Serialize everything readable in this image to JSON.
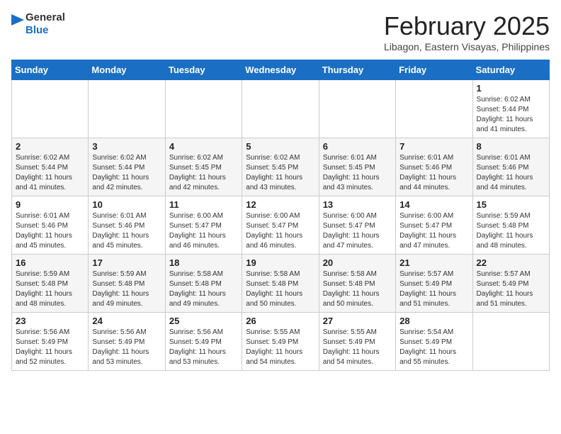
{
  "header": {
    "logo_general": "General",
    "logo_blue": "Blue",
    "month_title": "February 2025",
    "location": "Libagon, Eastern Visayas, Philippines"
  },
  "weekdays": [
    "Sunday",
    "Monday",
    "Tuesday",
    "Wednesday",
    "Thursday",
    "Friday",
    "Saturday"
  ],
  "weeks": [
    [
      {
        "day": "",
        "info": ""
      },
      {
        "day": "",
        "info": ""
      },
      {
        "day": "",
        "info": ""
      },
      {
        "day": "",
        "info": ""
      },
      {
        "day": "",
        "info": ""
      },
      {
        "day": "",
        "info": ""
      },
      {
        "day": "1",
        "info": "Sunrise: 6:02 AM\nSunset: 5:44 PM\nDaylight: 11 hours and 41 minutes."
      }
    ],
    [
      {
        "day": "2",
        "info": "Sunrise: 6:02 AM\nSunset: 5:44 PM\nDaylight: 11 hours and 41 minutes."
      },
      {
        "day": "3",
        "info": "Sunrise: 6:02 AM\nSunset: 5:44 PM\nDaylight: 11 hours and 42 minutes."
      },
      {
        "day": "4",
        "info": "Sunrise: 6:02 AM\nSunset: 5:45 PM\nDaylight: 11 hours and 42 minutes."
      },
      {
        "day": "5",
        "info": "Sunrise: 6:02 AM\nSunset: 5:45 PM\nDaylight: 11 hours and 43 minutes."
      },
      {
        "day": "6",
        "info": "Sunrise: 6:01 AM\nSunset: 5:45 PM\nDaylight: 11 hours and 43 minutes."
      },
      {
        "day": "7",
        "info": "Sunrise: 6:01 AM\nSunset: 5:46 PM\nDaylight: 11 hours and 44 minutes."
      },
      {
        "day": "8",
        "info": "Sunrise: 6:01 AM\nSunset: 5:46 PM\nDaylight: 11 hours and 44 minutes."
      }
    ],
    [
      {
        "day": "9",
        "info": "Sunrise: 6:01 AM\nSunset: 5:46 PM\nDaylight: 11 hours and 45 minutes."
      },
      {
        "day": "10",
        "info": "Sunrise: 6:01 AM\nSunset: 5:46 PM\nDaylight: 11 hours and 45 minutes."
      },
      {
        "day": "11",
        "info": "Sunrise: 6:00 AM\nSunset: 5:47 PM\nDaylight: 11 hours and 46 minutes."
      },
      {
        "day": "12",
        "info": "Sunrise: 6:00 AM\nSunset: 5:47 PM\nDaylight: 11 hours and 46 minutes."
      },
      {
        "day": "13",
        "info": "Sunrise: 6:00 AM\nSunset: 5:47 PM\nDaylight: 11 hours and 47 minutes."
      },
      {
        "day": "14",
        "info": "Sunrise: 6:00 AM\nSunset: 5:47 PM\nDaylight: 11 hours and 47 minutes."
      },
      {
        "day": "15",
        "info": "Sunrise: 5:59 AM\nSunset: 5:48 PM\nDaylight: 11 hours and 48 minutes."
      }
    ],
    [
      {
        "day": "16",
        "info": "Sunrise: 5:59 AM\nSunset: 5:48 PM\nDaylight: 11 hours and 48 minutes."
      },
      {
        "day": "17",
        "info": "Sunrise: 5:59 AM\nSunset: 5:48 PM\nDaylight: 11 hours and 49 minutes."
      },
      {
        "day": "18",
        "info": "Sunrise: 5:58 AM\nSunset: 5:48 PM\nDaylight: 11 hours and 49 minutes."
      },
      {
        "day": "19",
        "info": "Sunrise: 5:58 AM\nSunset: 5:48 PM\nDaylight: 11 hours and 50 minutes."
      },
      {
        "day": "20",
        "info": "Sunrise: 5:58 AM\nSunset: 5:48 PM\nDaylight: 11 hours and 50 minutes."
      },
      {
        "day": "21",
        "info": "Sunrise: 5:57 AM\nSunset: 5:49 PM\nDaylight: 11 hours and 51 minutes."
      },
      {
        "day": "22",
        "info": "Sunrise: 5:57 AM\nSunset: 5:49 PM\nDaylight: 11 hours and 51 minutes."
      }
    ],
    [
      {
        "day": "23",
        "info": "Sunrise: 5:56 AM\nSunset: 5:49 PM\nDaylight: 11 hours and 52 minutes."
      },
      {
        "day": "24",
        "info": "Sunrise: 5:56 AM\nSunset: 5:49 PM\nDaylight: 11 hours and 53 minutes."
      },
      {
        "day": "25",
        "info": "Sunrise: 5:56 AM\nSunset: 5:49 PM\nDaylight: 11 hours and 53 minutes."
      },
      {
        "day": "26",
        "info": "Sunrise: 5:55 AM\nSunset: 5:49 PM\nDaylight: 11 hours and 54 minutes."
      },
      {
        "day": "27",
        "info": "Sunrise: 5:55 AM\nSunset: 5:49 PM\nDaylight: 11 hours and 54 minutes."
      },
      {
        "day": "28",
        "info": "Sunrise: 5:54 AM\nSunset: 5:49 PM\nDaylight: 11 hours and 55 minutes."
      },
      {
        "day": "",
        "info": ""
      }
    ]
  ]
}
